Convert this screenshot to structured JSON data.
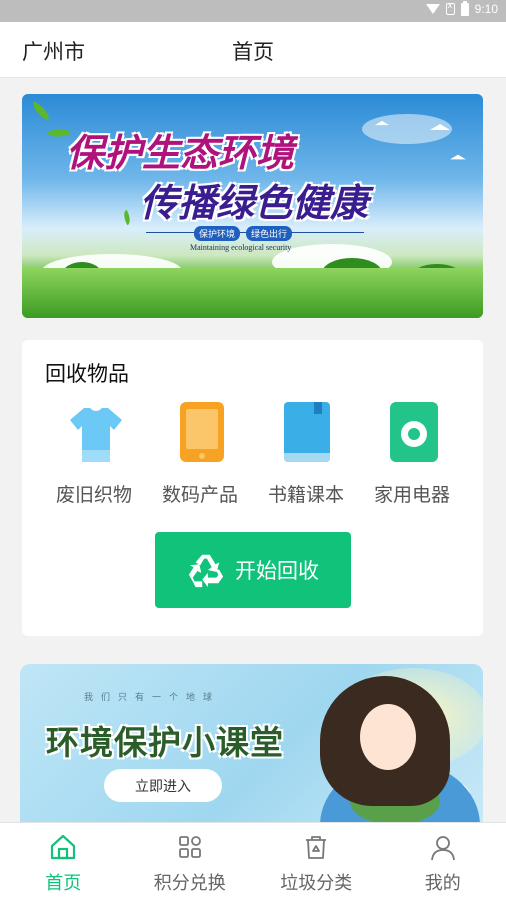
{
  "status_bar": {
    "time": "9:10"
  },
  "header": {
    "city": "广州市",
    "title": "首页"
  },
  "banner": {
    "line1": "保护生态环境",
    "line2": "传播绿色健康",
    "pills": [
      "保护环境",
      "绿色出行"
    ],
    "subtitle": "Maintaining ecological security"
  },
  "recycle": {
    "title": "回收物品",
    "categories": [
      {
        "label": "废旧织物",
        "icon": "shirt-icon",
        "color": "#6cc8f4"
      },
      {
        "label": "数码产品",
        "icon": "phone-icon",
        "color": "#f7a222"
      },
      {
        "label": "书籍课本",
        "icon": "book-icon",
        "color": "#3aaee6"
      },
      {
        "label": "家用电器",
        "icon": "washing-machine-icon",
        "color": "#22c48a"
      }
    ],
    "start_button": "开始回收"
  },
  "classroom": {
    "small_text": "我们只有一个地球",
    "title": "环境保护小课堂",
    "enter_button": "立即进入"
  },
  "tabbar": {
    "items": [
      {
        "label": "首页",
        "icon": "home-icon",
        "active": true
      },
      {
        "label": "积分兑换",
        "icon": "grid-icon",
        "active": false
      },
      {
        "label": "垃圾分类",
        "icon": "trash-bin-icon",
        "active": false
      },
      {
        "label": "我的",
        "icon": "user-icon",
        "active": false
      }
    ],
    "active_color": "#10c27a"
  }
}
